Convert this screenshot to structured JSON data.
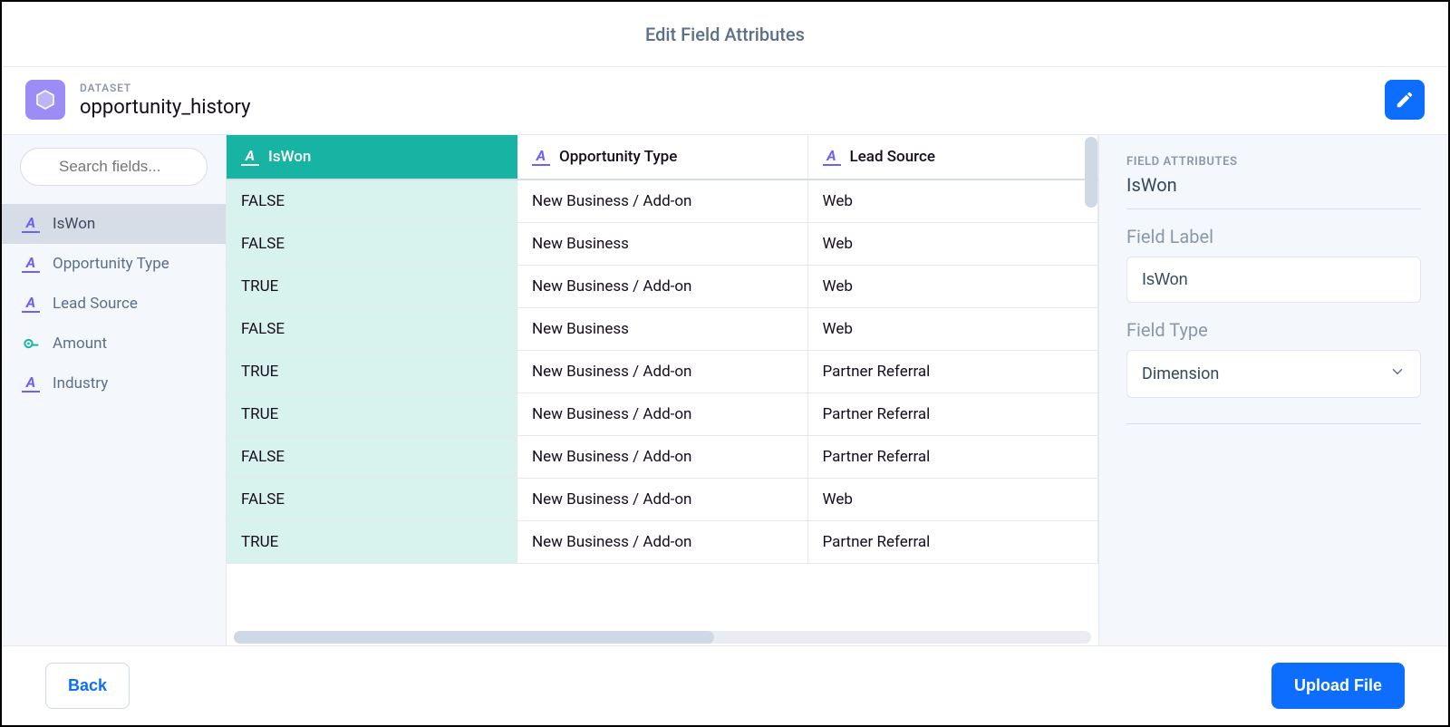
{
  "header": {
    "title": "Edit Field Attributes"
  },
  "dataset": {
    "kicker": "DATASET",
    "name": "opportunity_history"
  },
  "search": {
    "placeholder": "Search fields..."
  },
  "sidebar": {
    "items": [
      {
        "label": "IsWon",
        "type": "dimension",
        "selected": true
      },
      {
        "label": "Opportunity Type",
        "type": "dimension",
        "selected": false
      },
      {
        "label": "Lead Source",
        "type": "dimension",
        "selected": false
      },
      {
        "label": "Amount",
        "type": "measure",
        "selected": false
      },
      {
        "label": "Industry",
        "type": "dimension",
        "selected": false
      }
    ]
  },
  "table": {
    "columns": [
      {
        "label": "IsWon",
        "selected": true
      },
      {
        "label": "Opportunity Type",
        "selected": false
      },
      {
        "label": "Lead Source",
        "selected": false
      }
    ],
    "rows": [
      [
        "FALSE",
        "New Business / Add-on",
        "Web"
      ],
      [
        "FALSE",
        "New Business",
        "Web"
      ],
      [
        "TRUE",
        "New Business / Add-on",
        "Web"
      ],
      [
        "FALSE",
        "New Business",
        "Web"
      ],
      [
        "TRUE",
        "New Business / Add-on",
        "Partner Referral"
      ],
      [
        "TRUE",
        "New Business / Add-on",
        "Partner Referral"
      ],
      [
        "FALSE",
        "New Business / Add-on",
        "Partner Referral"
      ],
      [
        "FALSE",
        "New Business / Add-on",
        "Web"
      ],
      [
        "TRUE",
        "New Business / Add-on",
        "Partner Referral"
      ]
    ]
  },
  "attributes": {
    "section_label": "FIELD ATTRIBUTES",
    "field_name": "IsWon",
    "label_heading": "Field Label",
    "label_value": "IsWon",
    "type_heading": "Field Type",
    "type_value": "Dimension"
  },
  "footer": {
    "back": "Back",
    "upload": "Upload File"
  }
}
